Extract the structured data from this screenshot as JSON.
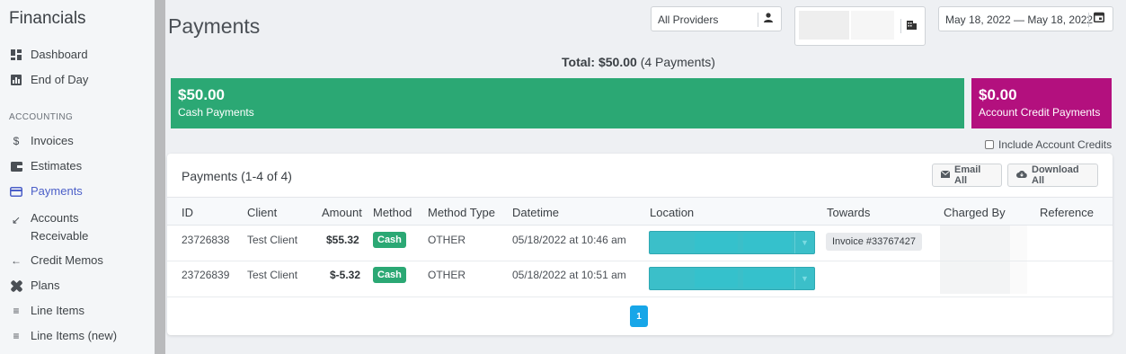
{
  "sidebar": {
    "title": "Financials",
    "top_items": [
      {
        "label": "Dashboard",
        "icon": "dashboard-icon"
      },
      {
        "label": "End of Day",
        "icon": "chart-icon"
      }
    ],
    "section_label": "ACCOUNTING",
    "items": [
      {
        "label": "Invoices",
        "icon": "dollar-icon"
      },
      {
        "label": "Estimates",
        "icon": "wallet-icon"
      },
      {
        "label": "Payments",
        "icon": "credit-card-icon",
        "active": true
      },
      {
        "label": "Accounts Receivable",
        "icon": "arrow-down-left-icon"
      },
      {
        "label": "Credit Memos",
        "icon": "arrow-left-icon"
      },
      {
        "label": "Plans",
        "icon": "bandage-icon"
      },
      {
        "label": "Line Items",
        "icon": "list-icon"
      },
      {
        "label": "Line Items (new)",
        "icon": "list-icon"
      }
    ]
  },
  "header": {
    "title": "Payments",
    "provider_select": "All Providers",
    "date_range": "May 18, 2022 — May 18, 2022"
  },
  "summary": {
    "total_label": "Total:",
    "total_amount": "$50.00",
    "total_count": "(4 Payments)",
    "cash_amount": "$50.00",
    "cash_label": "Cash Payments",
    "credit_amount": "$0.00",
    "credit_label": "Account Credit Payments",
    "include_credits_label": "Include Account Credits",
    "colors": {
      "cash": "#2ba874",
      "credit": "#b3107e"
    }
  },
  "panel": {
    "title": "Payments (1-4 of 4)",
    "email_all": "Email All",
    "download_all": "Download All",
    "columns": [
      "ID",
      "Client",
      "Amount",
      "Method",
      "Method Type",
      "Datetime",
      "Location",
      "Towards",
      "Charged By",
      "Reference"
    ],
    "rows": [
      {
        "id": "23726838",
        "client": "Test Client",
        "amount": "$55.32",
        "method": "Cash",
        "method_type": "OTHER",
        "datetime": "05/18/2022 at 10:46 am",
        "towards": "Invoice #33767427"
      },
      {
        "id": "23726839",
        "client": "Test Client",
        "amount": "$-5.32",
        "method": "Cash",
        "method_type": "OTHER",
        "datetime": "05/18/2022 at 10:51 am",
        "towards": ""
      }
    ],
    "page": "1"
  }
}
